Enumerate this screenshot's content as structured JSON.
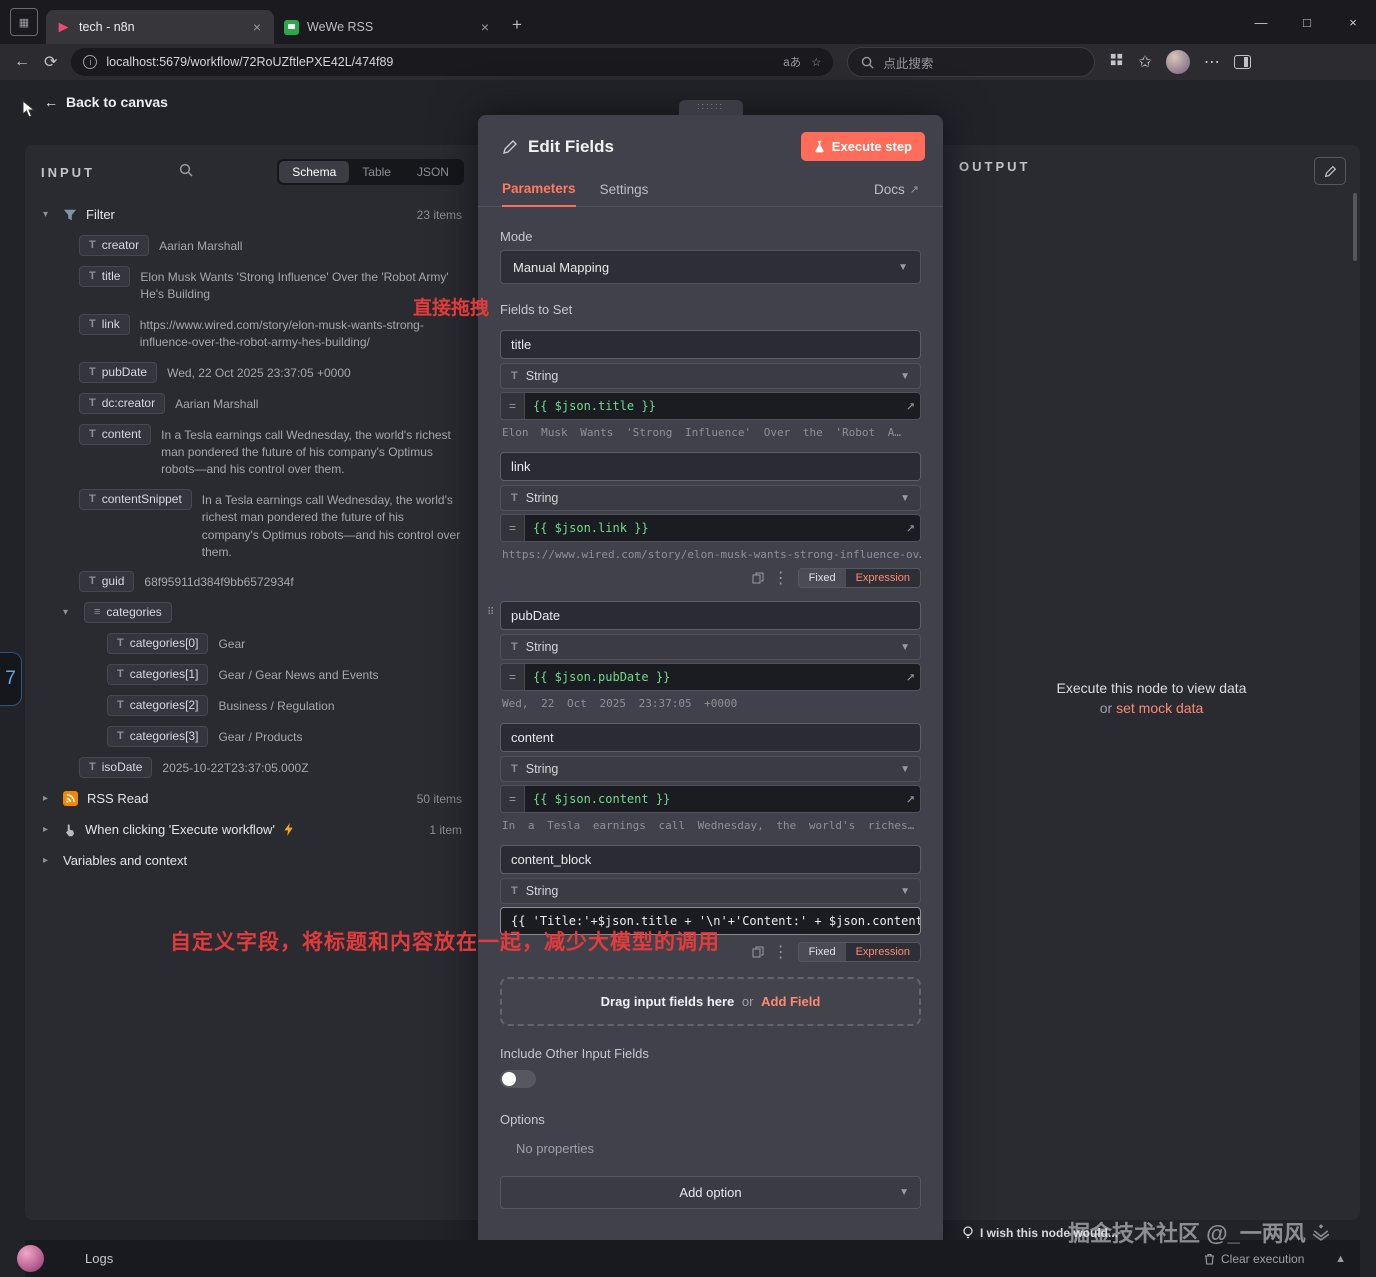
{
  "browser": {
    "tab1": "tech - n8n",
    "tab2": "WeWe RSS",
    "url": "localhost:5679/workflow/72RoUZftlePXE42L/474f89",
    "translate_icon": "aあ",
    "search_placeholder": "点此搜索"
  },
  "canvas": {
    "back": "Back to canvas"
  },
  "input_panel": {
    "title": "INPUT",
    "tab_schema": "Schema",
    "tab_table": "Table",
    "tab_json": "JSON",
    "filter": {
      "name": "Filter",
      "count": "23 items"
    },
    "fields": [
      {
        "key": "creator",
        "value": "Aarian Marshall"
      },
      {
        "key": "title",
        "value": "Elon Musk Wants 'Strong Influence' Over the 'Robot Army' He's Building"
      },
      {
        "key": "link",
        "value": "https://www.wired.com/story/elon-musk-wants-strong-influence-over-the-robot-army-hes-building/"
      },
      {
        "key": "pubDate",
        "value": "Wed, 22 Oct 2025 23:37:05 +0000"
      },
      {
        "key": "dc:creator",
        "value": "Aarian Marshall"
      },
      {
        "key": "content",
        "value": "In a Tesla earnings call Wednesday, the world's richest man pondered the future of his company's Optimus robots—and his control over them."
      },
      {
        "key": "contentSnippet",
        "value": "In a Tesla earnings call Wednesday, the world's richest man pondered the future of his company's Optimus robots—and his control over them."
      },
      {
        "key": "guid",
        "value": "68f95911d384f9bb6572934f"
      },
      {
        "key": "categories",
        "value": ""
      },
      {
        "key": "categories[0]",
        "value": "Gear"
      },
      {
        "key": "categories[1]",
        "value": "Gear / Gear News and Events"
      },
      {
        "key": "categories[2]",
        "value": "Business / Regulation"
      },
      {
        "key": "categories[3]",
        "value": "Gear / Products"
      },
      {
        "key": "isoDate",
        "value": "2025-10-22T23:37:05.000Z"
      }
    ],
    "rss": {
      "name": "RSS Read",
      "count": "50 items"
    },
    "manual": {
      "name": "When clicking 'Execute workflow'",
      "count": "1 item"
    },
    "vars": {
      "name": "Variables and context"
    }
  },
  "editor": {
    "title": "Edit Fields",
    "execute": "Execute step",
    "tab_parameters": "Parameters",
    "tab_settings": "Settings",
    "docs": "Docs",
    "mode_label": "Mode",
    "mode_value": "Manual Mapping",
    "fields_to_set": "Fields to Set",
    "fields": [
      {
        "name": "title",
        "type": "String",
        "expr": "{{ $json.title }}",
        "preview": "Elon Musk Wants 'Strong Influence' Over the 'Robot A…"
      },
      {
        "name": "link",
        "type": "String",
        "expr": "{{ $json.link }}",
        "preview": "https://www.wired.com/story/elon-musk-wants-strong-influence-ov…"
      },
      {
        "name": "pubDate",
        "type": "String",
        "expr": "{{ $json.pubDate }}",
        "preview": "Wed, 22 Oct 2025 23:37:05 +0000"
      },
      {
        "name": "content",
        "type": "String",
        "expr": "{{ $json.content }}",
        "preview": "In a Tesla earnings call Wednesday, the world's riches…"
      },
      {
        "name": "content_block",
        "type": "String",
        "expr": "{{ 'Title:'+$json.title + '\\n'+'Content:' + $json.content }}"
      }
    ],
    "fixed": "Fixed",
    "expression": "Expression",
    "drag_here": "Drag input fields here",
    "or": "or",
    "add_field": "Add Field",
    "include_other": "Include Other Input Fields",
    "options": "Options",
    "no_properties": "No properties",
    "add_option": "Add option"
  },
  "output_panel": {
    "title": "OUTPUT",
    "message": "Execute this node to view data",
    "or": "or",
    "mock": "set mock data"
  },
  "footer": {
    "logs": "Logs",
    "wish": "I wish this node would...",
    "watermark": "掘金技术社区 @_一两风",
    "clear": "Clear execution"
  },
  "annotations": {
    "drag_note": "直接拖拽",
    "custom_note": "自定义字段，将标题和内容放在一起，减少大模型的调用"
  },
  "edge_badge": "7",
  "accent": {
    "orange": "#ff6d5a",
    "expr_green": "#6fdc8c",
    "annotation_red": "#e23b3b"
  }
}
